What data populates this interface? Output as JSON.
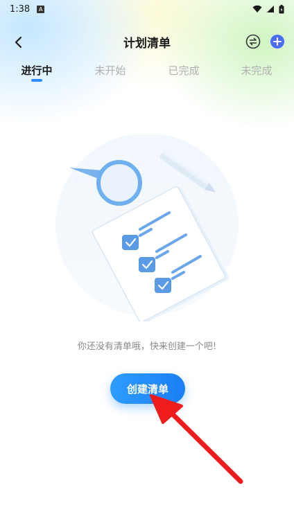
{
  "status_bar": {
    "time": "1:38",
    "notification_icon": "a-icon",
    "wifi_icon": "wifi-icon",
    "signal_icon": "signal-icon",
    "battery_icon": "battery-icon"
  },
  "nav": {
    "title": "计划清单",
    "back_icon": "back-arrow-icon",
    "switch_icon": "swap-icon",
    "add_icon": "plus-icon",
    "accent_color": "#4a6cf7"
  },
  "tabs": [
    {
      "label": "进行中",
      "active": true
    },
    {
      "label": "未开始",
      "active": false
    },
    {
      "label": "已完成",
      "active": false
    },
    {
      "label": "未完成",
      "active": false
    }
  ],
  "empty_state": {
    "illustration": "empty-checklist-illustration",
    "message": "你还没有清单哦，快来创建一个吧!",
    "button_label": "创建清单",
    "button_color": "#2d9cff"
  },
  "annotation": {
    "arrow_color": "#ee1c1c"
  }
}
